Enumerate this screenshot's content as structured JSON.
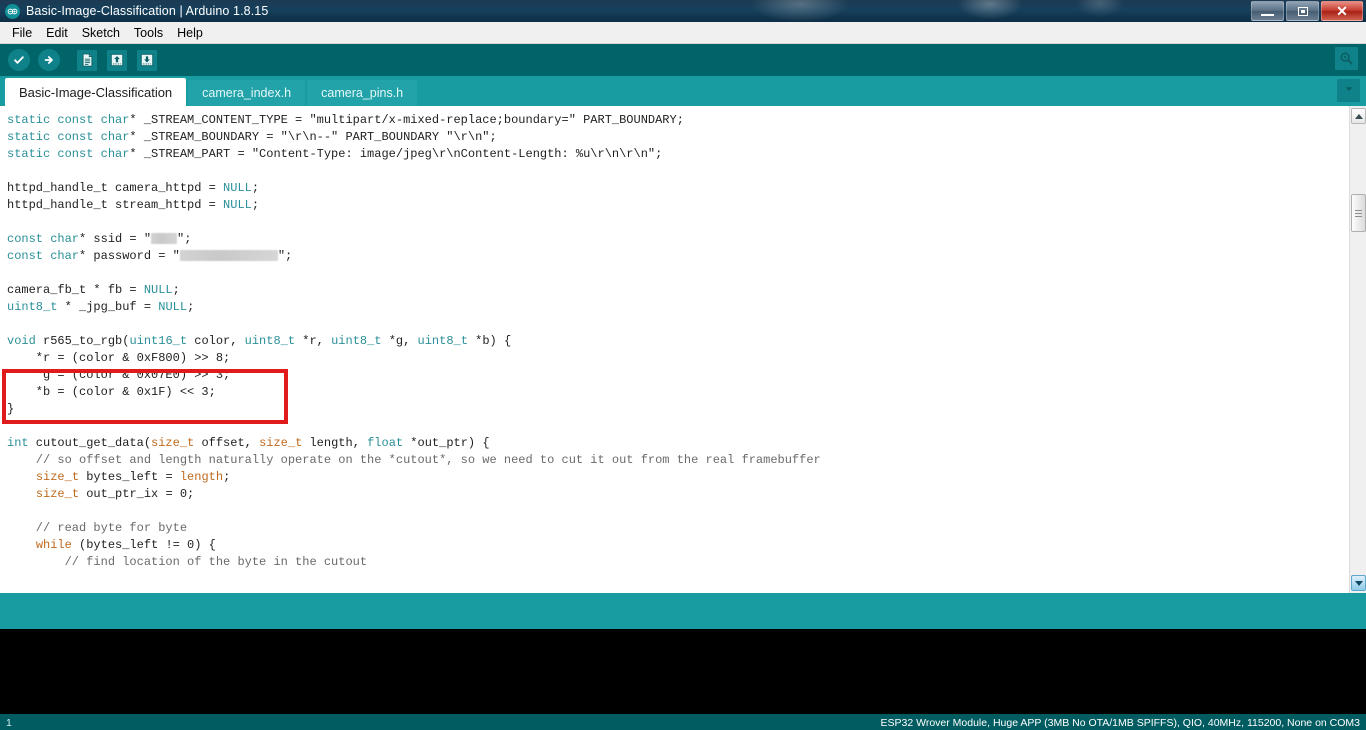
{
  "window": {
    "title": "Basic-Image-Classification | Arduino 1.8.15",
    "logo_text": "∞",
    "controls": {
      "minimize": "minimize-icon",
      "restore": "restore-icon",
      "close": "close-icon"
    }
  },
  "menubar": {
    "items": [
      {
        "label": "File"
      },
      {
        "label": "Edit"
      },
      {
        "label": "Sketch"
      },
      {
        "label": "Tools"
      },
      {
        "label": "Help"
      }
    ]
  },
  "toolbar": {
    "buttons": [
      {
        "name": "verify-button",
        "icon": "checkmark-icon",
        "tooltip": "Verify"
      },
      {
        "name": "upload-button",
        "icon": "right-arrow-icon",
        "tooltip": "Upload"
      },
      {
        "name": "new-button",
        "icon": "new-document-icon",
        "tooltip": "New"
      },
      {
        "name": "open-button",
        "icon": "up-arrow-icon",
        "tooltip": "Open"
      },
      {
        "name": "save-button",
        "icon": "down-arrow-icon",
        "tooltip": "Save"
      }
    ],
    "serial_monitor": {
      "name": "serial-monitor-button",
      "icon": "magnifier-icon",
      "tooltip": "Serial Monitor"
    }
  },
  "tabs": {
    "items": [
      {
        "label": "Basic-Image-Classification",
        "active": true
      },
      {
        "label": "camera_index.h",
        "active": false
      },
      {
        "label": "camera_pins.h",
        "active": false
      }
    ],
    "menu_icon": "chevron-down-icon"
  },
  "editor": {
    "lines": [
      [
        {
          "t": "static const char",
          "c": "k"
        },
        {
          "t": "* _STREAM_CONTENT_TYPE = \"multipart/x-mixed-replace;boundary=\" PART_BOUNDARY;",
          "c": ""
        }
      ],
      [
        {
          "t": "static const char",
          "c": "k"
        },
        {
          "t": "* _STREAM_BOUNDARY = \"\\r\\n--\" PART_BOUNDARY \"\\r\\n\";",
          "c": ""
        }
      ],
      [
        {
          "t": "static const char",
          "c": "k"
        },
        {
          "t": "* _STREAM_PART = \"Content-Type: image/jpeg\\r\\nContent-Length: %u\\r\\n\\r\\n\";",
          "c": ""
        }
      ],
      [],
      [
        {
          "t": "httpd_handle_t camera_httpd = ",
          "c": ""
        },
        {
          "t": "NULL",
          "c": "k"
        },
        {
          "t": ";",
          "c": ""
        }
      ],
      [
        {
          "t": "httpd_handle_t stream_httpd = ",
          "c": ""
        },
        {
          "t": "NULL",
          "c": "k"
        },
        {
          "t": ";",
          "c": ""
        }
      ],
      [],
      [
        {
          "t": "const char",
          "c": "k"
        },
        {
          "t": "* ssid = \"",
          "c": ""
        },
        {
          "t": "REDACT:26",
          "c": "redact"
        },
        {
          "t": "\";",
          "c": ""
        }
      ],
      [
        {
          "t": "const char",
          "c": "k"
        },
        {
          "t": "* password = \"",
          "c": ""
        },
        {
          "t": "REDACT:98",
          "c": "redact"
        },
        {
          "t": "\";",
          "c": ""
        }
      ],
      [],
      [
        {
          "t": "camera_fb_t * fb = ",
          "c": ""
        },
        {
          "t": "NULL",
          "c": "k"
        },
        {
          "t": ";",
          "c": ""
        }
      ],
      [
        {
          "t": "uint8_t",
          "c": "k"
        },
        {
          "t": " * _jpg_buf = ",
          "c": ""
        },
        {
          "t": "NULL",
          "c": "k"
        },
        {
          "t": ";",
          "c": ""
        }
      ],
      [],
      [
        {
          "t": "void",
          "c": "k"
        },
        {
          "t": " r565_to_rgb(",
          "c": ""
        },
        {
          "t": "uint16_t",
          "c": "k"
        },
        {
          "t": " color, ",
          "c": ""
        },
        {
          "t": "uint8_t",
          "c": "k"
        },
        {
          "t": " *r, ",
          "c": ""
        },
        {
          "t": "uint8_t",
          "c": "k"
        },
        {
          "t": " *g, ",
          "c": ""
        },
        {
          "t": "uint8_t",
          "c": "k"
        },
        {
          "t": " *b) {",
          "c": ""
        }
      ],
      [
        {
          "t": "    *r = (color & 0xF800) >> 8;",
          "c": ""
        }
      ],
      [
        {
          "t": "    *g = (color & 0x07E0) >> 3;",
          "c": ""
        }
      ],
      [
        {
          "t": "    *b = (color & 0x1F) << 3;",
          "c": ""
        }
      ],
      [
        {
          "t": "}",
          "c": ""
        }
      ],
      [],
      [
        {
          "t": "int",
          "c": "k"
        },
        {
          "t": " cutout_get_data(",
          "c": ""
        },
        {
          "t": "size_t",
          "c": "kw"
        },
        {
          "t": " offset, ",
          "c": ""
        },
        {
          "t": "size_t",
          "c": "kw"
        },
        {
          "t": " length, ",
          "c": ""
        },
        {
          "t": "float",
          "c": "k"
        },
        {
          "t": " *out_ptr) {",
          "c": ""
        }
      ],
      [
        {
          "t": "    // so offset and length naturally operate on the *cutout*, so we need to cut it out from the real framebuffer",
          "c": "cm"
        }
      ],
      [
        {
          "t": "    ",
          "c": ""
        },
        {
          "t": "size_t",
          "c": "kw"
        },
        {
          "t": " bytes_left = ",
          "c": ""
        },
        {
          "t": "length",
          "c": "kw"
        },
        {
          "t": ";",
          "c": ""
        }
      ],
      [
        {
          "t": "    ",
          "c": ""
        },
        {
          "t": "size_t",
          "c": "kw"
        },
        {
          "t": " out_ptr_ix = 0;",
          "c": ""
        }
      ],
      [],
      [
        {
          "t": "    // read byte for byte",
          "c": "cm"
        }
      ],
      [
        {
          "t": "    ",
          "c": ""
        },
        {
          "t": "while",
          "c": "kw"
        },
        {
          "t": " (bytes_left != 0) {",
          "c": ""
        }
      ],
      [
        {
          "t": "        // find location of the byte in the cutout",
          "c": "cm"
        }
      ]
    ]
  },
  "scrollbar": {
    "up_arrow": "scroll-up-arrow-icon",
    "down_arrow": "scroll-down-arrow-icon",
    "thumb": "scroll-thumb"
  },
  "statusbar": {
    "line_number": "1",
    "board_info": "ESP32 Wrover Module, Huge APP (3MB No OTA/1MB SPIFFS), QIO, 40MHz, 115200, None on COM3"
  },
  "colors": {
    "toolbar_teal": "#006468",
    "tabbar_teal": "#189ba1",
    "status_teal": "#005c60",
    "keyword_teal": "#2a9098",
    "keyword_orange": "#c06a1e",
    "comment_gray": "#6a6a6a",
    "highlight_red": "#e01b1b"
  }
}
